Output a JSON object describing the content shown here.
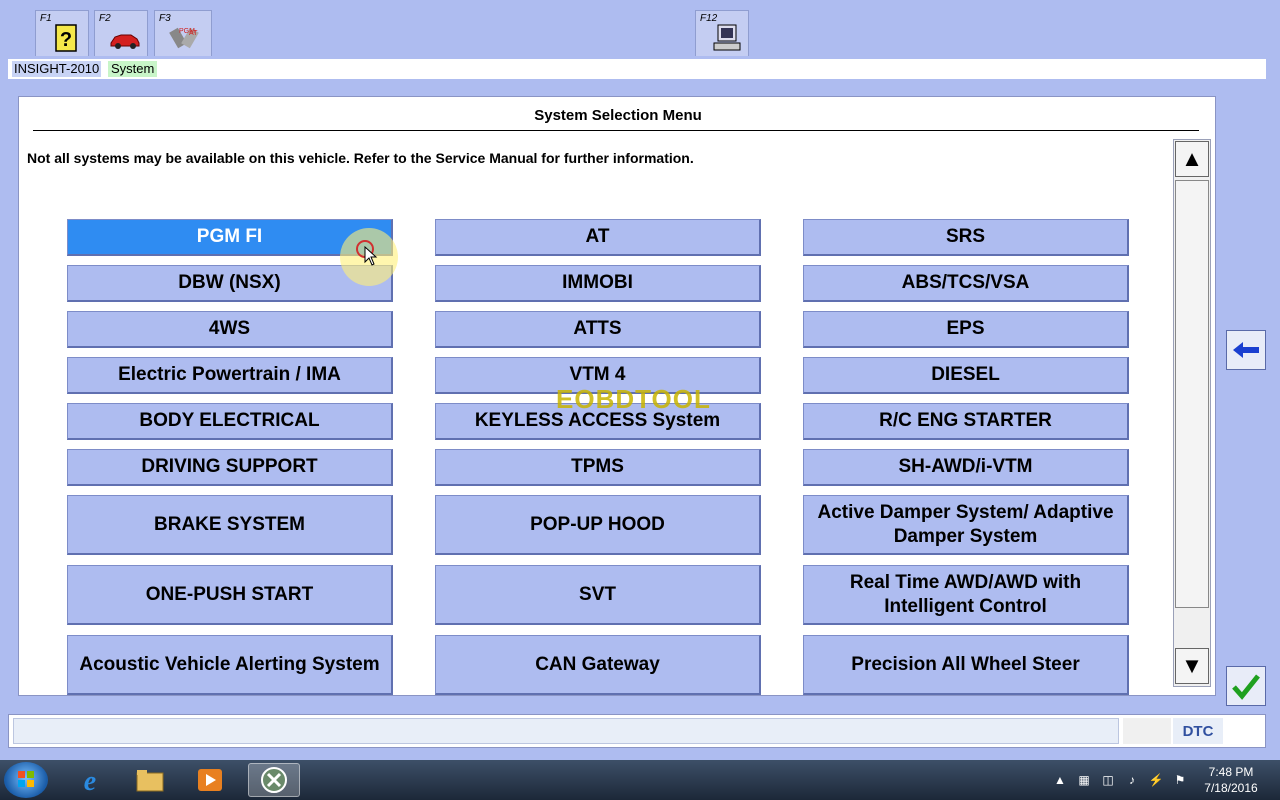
{
  "toolbar": {
    "keys": [
      {
        "label": "F1",
        "icon": "help-question-icon"
      },
      {
        "label": "F2",
        "icon": "car-icon"
      },
      {
        "label": "F3",
        "icon": "pgm-at-tools-icon"
      },
      {
        "label": "F12",
        "icon": "computer-icon"
      }
    ]
  },
  "breadcrumb": {
    "vehicle": "INSIGHT-2010",
    "section": "System"
  },
  "main": {
    "title": "System Selection Menu",
    "notice": "Not all systems may be available on this vehicle. Refer to the Service Manual for further information.",
    "systems": [
      "PGM FI",
      "AT",
      "SRS",
      "DBW (NSX)",
      "IMMOBI",
      "ABS/TCS/VSA",
      "4WS",
      "ATTS",
      "EPS",
      "Electric Powertrain / IMA",
      "VTM 4",
      "DIESEL",
      "BODY ELECTRICAL",
      "KEYLESS ACCESS System",
      "R/C ENG STARTER",
      "DRIVING SUPPORT",
      "TPMS",
      "SH-AWD/i-VTM",
      "BRAKE SYSTEM",
      "POP-UP HOOD",
      "Active Damper System/ Adaptive Damper System",
      "ONE-PUSH START",
      "SVT",
      "Real Time AWD/AWD with Intelligent Control",
      "Acoustic Vehicle Alerting System",
      "CAN Gateway",
      "Precision All Wheel Steer"
    ],
    "selected": "PGM FI"
  },
  "scrollbar": {
    "up_icon": "scroll-up-arrow-icon",
    "down_icon": "scroll-down-arrow-icon"
  },
  "side_buttons": {
    "back_icon": "back-arrow-icon",
    "ok_icon": "checkmark-icon"
  },
  "statusbar": {
    "dtc_label": "DTC"
  },
  "watermark": "EOBDTOOL",
  "taskbar": {
    "apps": [
      "internet-explorer-icon",
      "file-explorer-icon",
      "media-player-icon",
      "hds-app-icon"
    ],
    "time": "7:48 PM",
    "date": "7/18/2016"
  },
  "colors": {
    "background": "#aebcf0",
    "button": "#aebcf0",
    "selected_button": "#2f8cf2",
    "dtc_text": "#3050a0"
  }
}
